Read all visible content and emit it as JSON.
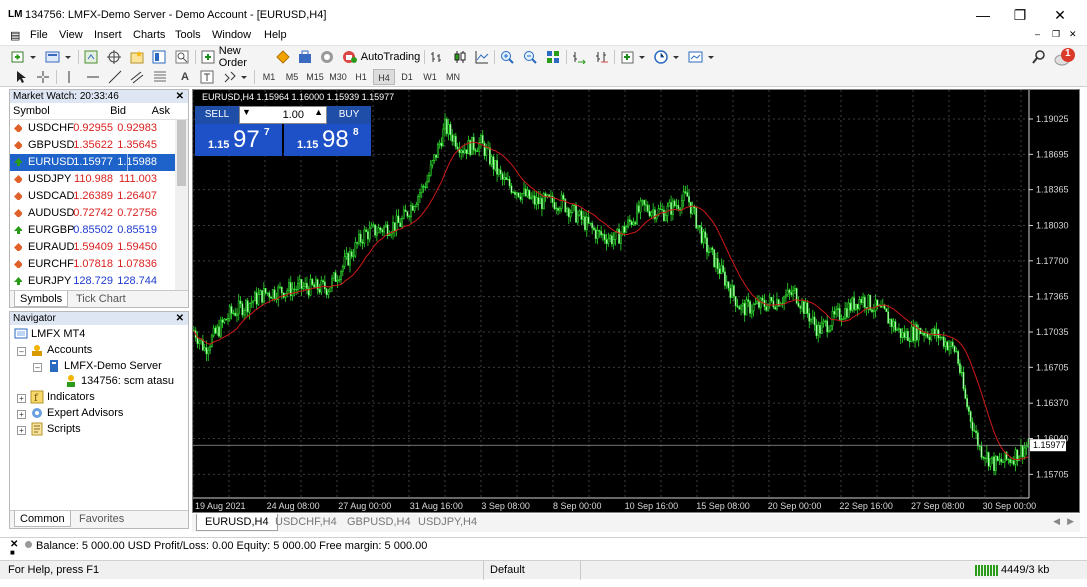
{
  "window": {
    "logo": "LM",
    "title": "134756: LMFX-Demo Server - Demo Account - [EURUSD,H4]"
  },
  "menu": [
    "File",
    "View",
    "Insert",
    "Charts",
    "Tools",
    "Window",
    "Help"
  ],
  "toolbar": {
    "new_order": "New Order",
    "autotrading": "AutoTrading",
    "notification_count": "1"
  },
  "timeframes": [
    "M1",
    "M5",
    "M15",
    "M30",
    "H1",
    "H4",
    "D1",
    "W1",
    "MN"
  ],
  "active_timeframe": "H4",
  "market_watch": {
    "title": "Market Watch: 20:33:46",
    "columns": [
      "Symbol",
      "Bid",
      "Ask"
    ],
    "rows": [
      {
        "symbol": "USDCHF",
        "bid": "0.92955",
        "ask": "0.92983",
        "color": "#d9211f"
      },
      {
        "symbol": "GBPUSD",
        "bid": "1.35622",
        "ask": "1.35645",
        "color": "#d9211f"
      },
      {
        "symbol": "EURUSD",
        "bid": "1.15977",
        "ask": "1.15988",
        "color": "#ffffff"
      },
      {
        "symbol": "USDJPY",
        "bid": "110.988",
        "ask": "111.003",
        "color": "#d9211f"
      },
      {
        "symbol": "USDCAD",
        "bid": "1.26389",
        "ask": "1.26407",
        "color": "#d9211f"
      },
      {
        "symbol": "AUDUSD",
        "bid": "0.72742",
        "ask": "0.72756",
        "color": "#d9211f"
      },
      {
        "symbol": "EURGBP",
        "bid": "0.85502",
        "ask": "0.85519",
        "color": "#1f3bd1"
      },
      {
        "symbol": "EURAUD",
        "bid": "1.59409",
        "ask": "1.59450",
        "color": "#d9211f"
      },
      {
        "symbol": "EURCHF",
        "bid": "1.07818",
        "ask": "1.07836",
        "color": "#d9211f"
      },
      {
        "symbol": "EURJPY",
        "bid": "128.729",
        "ask": "128.744",
        "color": "#1f3bd1"
      }
    ],
    "tabs": [
      "Symbols",
      "Tick Chart"
    ]
  },
  "navigator": {
    "title": "Navigator",
    "root": "LMFX MT4",
    "accounts": "Accounts",
    "server": "LMFX-Demo Server",
    "account": "134756: scm atasu",
    "indicators": "Indicators",
    "experts": "Expert Advisors",
    "scripts": "Scripts",
    "tabs": [
      "Common",
      "Favorites"
    ]
  },
  "chart": {
    "header": "EURUSD,H4  1.15964 1.16000 1.15939 1.15977",
    "trade": {
      "sell": "SELL",
      "buy": "BUY",
      "lot": "1.00",
      "bid_small": "1.15",
      "bid_big": "97",
      "bid_sup": "7",
      "ask_small": "1.15",
      "ask_big": "98",
      "ask_sup": "8"
    },
    "price_labels": [
      "1.19025",
      "1.18695",
      "1.18365",
      "1.18030",
      "1.17700",
      "1.17365",
      "1.17035",
      "1.16705",
      "1.16370",
      "1.16040",
      "1.15705"
    ],
    "current_price": "1.15977",
    "time_labels": [
      "19 Aug 2021",
      "24 Aug 08:00",
      "27 Aug 00:00",
      "31 Aug 16:00",
      "3 Sep 08:00",
      "8 Sep 00:00",
      "10 Sep 16:00",
      "15 Sep 08:00",
      "20 Sep 00:00",
      "22 Sep 16:00",
      "27 Sep 08:00",
      "30 Sep 00:00"
    ],
    "tabs": [
      "EURUSD,H4",
      "USDCHF,H4",
      "GBPUSD,H4",
      "USDJPY,H4"
    ]
  },
  "terminal": {
    "balance_line": "Balance: 5 000.00 USD  Profit/Loss: 0.00  Equity: 5 000.00  Free margin: 5 000.00"
  },
  "status": {
    "help": "For Help, press F1",
    "profile": "Default",
    "traffic": "4449/3 kb"
  }
}
